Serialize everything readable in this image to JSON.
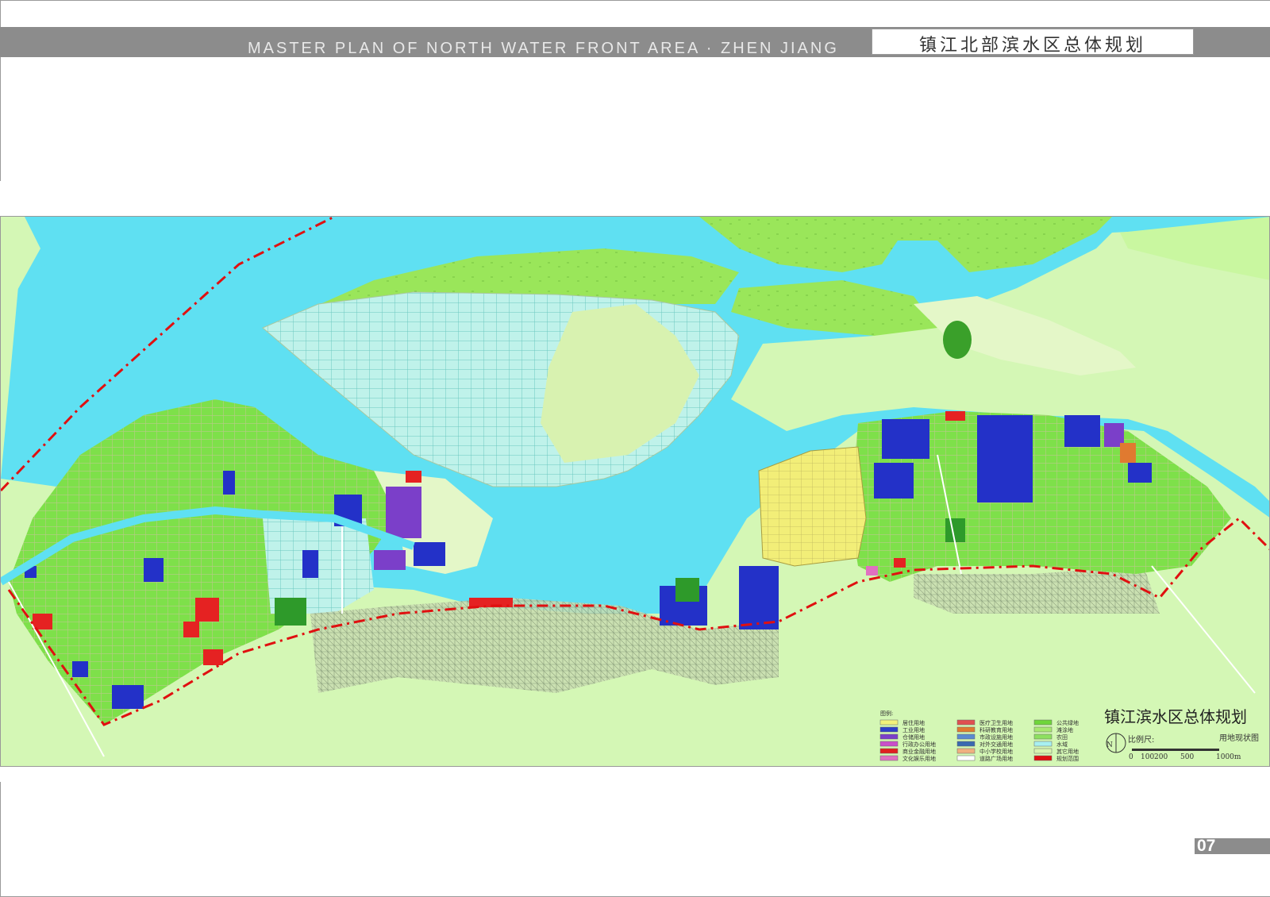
{
  "header": {
    "title_en": "MASTER PLAN OF NORTH WATER FRONT AREA · ZHEN  JIANG",
    "title_cn": "镇江北部滨水区总体规划"
  },
  "map": {
    "title": "镇江滨水区总体规划",
    "subtitle": "用地现状图",
    "north_label": "N",
    "scale_label": "比例尺:",
    "scale_ticks": [
      "0",
      "100",
      "200",
      "500",
      "1000m"
    ],
    "legend_title": "图例:",
    "legend": [
      {
        "label": "居住用地",
        "color": "#f2f27a"
      },
      {
        "label": "工业用地",
        "color": "#2d3fc9"
      },
      {
        "label": "仓储用地",
        "color": "#7b3fc9"
      },
      {
        "label": "行政办公用地",
        "color": "#c94fc9"
      },
      {
        "label": "商业金融用地",
        "color": "#e02020"
      },
      {
        "label": "文化娱乐用地",
        "color": "#e070c0"
      },
      {
        "label": "医疗卫生用地",
        "color": "#e05050"
      },
      {
        "label": "科研教育用地",
        "color": "#e07a30"
      },
      {
        "label": "市政设施用地",
        "color": "#5a8ad0"
      },
      {
        "label": "对外交通用地",
        "color": "#3a6ab0"
      },
      {
        "label": "中小学校用地",
        "color": "#f0b080"
      },
      {
        "label": "道路广场用地",
        "color": "#ffffff"
      },
      {
        "label": "公共绿地",
        "color": "#6fd63a"
      },
      {
        "label": "滩涂地",
        "color": "#a8e870"
      },
      {
        "label": "农田",
        "color": "#8ee060"
      },
      {
        "label": "水域",
        "color": "#a8f0f0"
      },
      {
        "label": "其它用地",
        "color": "#d8f5b0"
      },
      {
        "label": "规划范围",
        "color": "#e01010"
      }
    ],
    "colors": {
      "water": "#5fe0f2",
      "land_background": "#d4f7b5",
      "sandbar": "#9ae65a",
      "pond_grid": "#bff2ea",
      "urban_green": "#7ee04a",
      "industrial": "#2331c8",
      "residential": "#f2ee78",
      "commercial": "#e52222",
      "boundary": "#e01010"
    }
  },
  "page_number": "07"
}
